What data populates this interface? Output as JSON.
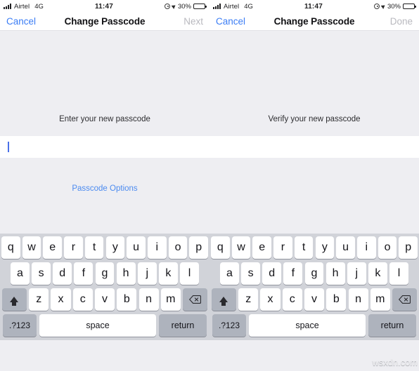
{
  "panels": [
    {
      "id": "enter",
      "status": {
        "signal_icon": "signal-bars-icon",
        "carrier": "Airtel",
        "network": "4G",
        "time": "11:47",
        "alarm_icon": "alarm-clock-icon",
        "location_icon": "location-arrow-icon",
        "battery_percent": "30%",
        "battery_icon": "battery-icon",
        "battery_level": 30
      },
      "nav": {
        "left_label": "Cancel",
        "title": "Change Passcode",
        "right_label": "Next",
        "right_disabled": true
      },
      "prompt": "Enter your new passcode",
      "field_value": "",
      "options_label": "Passcode Options",
      "show_options": true
    },
    {
      "id": "verify",
      "status": {
        "signal_icon": "signal-bars-icon",
        "carrier": "Airtel",
        "network": "4G",
        "time": "11:47",
        "alarm_icon": "alarm-clock-icon",
        "location_icon": "location-arrow-icon",
        "battery_percent": "30%",
        "battery_icon": "battery-icon",
        "battery_level": 30
      },
      "nav": {
        "left_label": "Cancel",
        "title": "Change Passcode",
        "right_label": "Done",
        "right_disabled": true
      },
      "prompt": "Verify your new passcode",
      "field_value": "",
      "options_label": "",
      "show_options": false
    }
  ],
  "keyboard": {
    "row1": [
      "q",
      "w",
      "e",
      "r",
      "t",
      "y",
      "u",
      "i",
      "o",
      "p"
    ],
    "row2": [
      "a",
      "s",
      "d",
      "f",
      "g",
      "h",
      "j",
      "k",
      "l"
    ],
    "row3": [
      "z",
      "x",
      "c",
      "v",
      "b",
      "n",
      "m"
    ],
    "shift_icon": "shift-arrow-icon",
    "delete_icon": "delete-backspace-icon",
    "numeric_label": ".?123",
    "space_label": "space",
    "return_label": "return"
  },
  "watermark": "wsxdn.com",
  "colors": {
    "accent_blue": "#3b7df5",
    "link_blue": "#4c8bf0",
    "disabled_gray": "#b9b9bf",
    "content_bg": "#eeeef2",
    "keyboard_bg": "#d1d3d9",
    "key_white": "#ffffff",
    "key_gray": "#aeb3bd",
    "caret_blue": "#4a70e8"
  }
}
